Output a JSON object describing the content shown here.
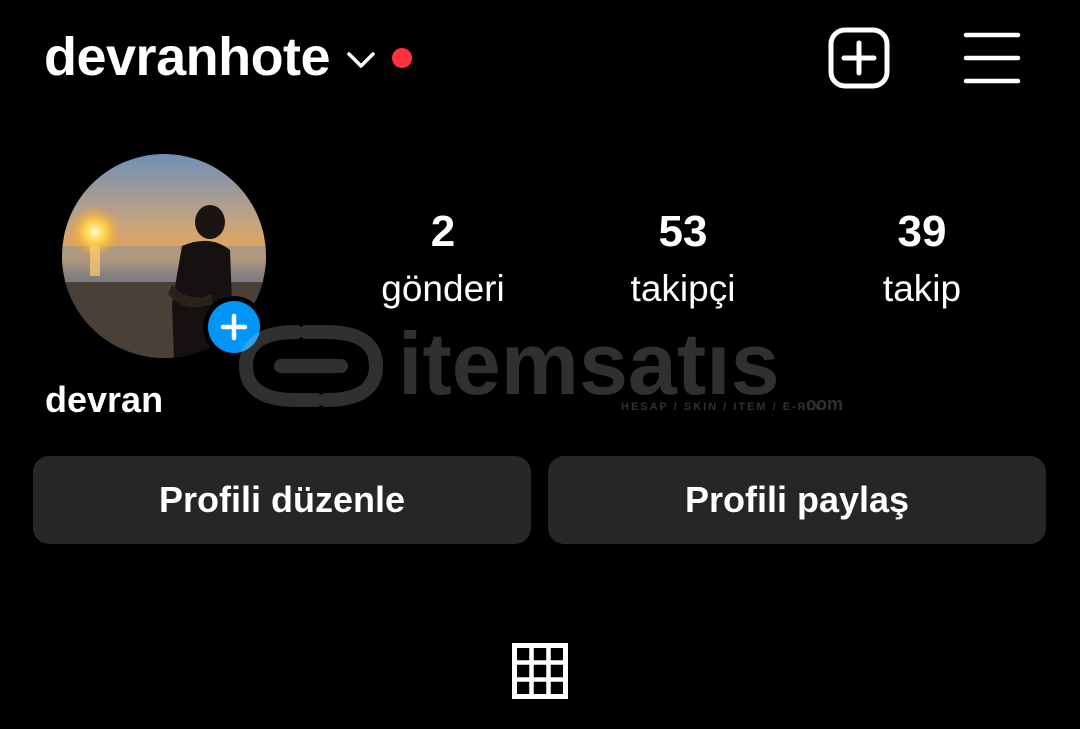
{
  "header": {
    "username": "devranhote",
    "icons": {
      "dropdown": "chevron-down-icon",
      "notification": "red-dot",
      "new_post": "plus-square-icon",
      "menu": "hamburger-menu-icon"
    },
    "notification_color": "#ff3040"
  },
  "profile": {
    "display_name": "devran",
    "avatar_alt": "profile photo at sunset on beach",
    "add_story_color": "#0095f6"
  },
  "stats": [
    {
      "value": "2",
      "label": "gönderi"
    },
    {
      "value": "53",
      "label": "takipçi"
    },
    {
      "value": "39",
      "label": "takip"
    }
  ],
  "actions": {
    "edit_label": "Profili düzenle",
    "share_label": "Profili paylaş"
  },
  "tabs": {
    "grid_icon": "grid-icon"
  },
  "watermark": {
    "brand": "itemsatıs",
    "tagline": "HESAP / SKIN / ITEM / E-PIN",
    "suffix": ".com"
  }
}
